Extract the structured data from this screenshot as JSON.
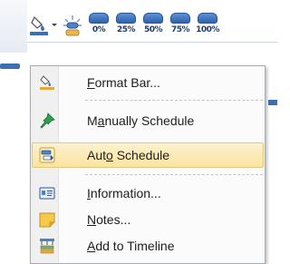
{
  "toolbar": {
    "buttons": [
      {
        "name": "bar-color-icon"
      },
      {
        "name": "dropdown-arrow-icon"
      },
      {
        "name": "milestone-icon"
      }
    ],
    "percent_buttons": [
      {
        "label": "0%",
        "complete": 0
      },
      {
        "label": "25%",
        "complete": 0.25
      },
      {
        "label": "50%",
        "complete": 0.5
      },
      {
        "label": "75%",
        "complete": 0.75
      },
      {
        "label": "100%",
        "complete": 1
      }
    ]
  },
  "menu": {
    "items": [
      {
        "icon": "format-bar-icon",
        "pre": "",
        "key": "F",
        "post": "ormat Bar...",
        "highlighted": false
      },
      {
        "icon": "pin-icon",
        "pre": "M",
        "key": "a",
        "post": "nually Schedule",
        "highlighted": false
      },
      {
        "icon": "auto-schedule-icon",
        "pre": "Aut",
        "key": "o",
        "post": " Schedule",
        "highlighted": true
      },
      {
        "icon": "information-icon",
        "pre": "",
        "key": "I",
        "post": "nformation...",
        "highlighted": false
      },
      {
        "icon": "notes-icon",
        "pre": "",
        "key": "N",
        "post": "otes...",
        "highlighted": false
      },
      {
        "icon": "add-to-timeline-icon",
        "pre": "",
        "key": "A",
        "post": "dd to Timeline",
        "highlighted": false
      }
    ]
  },
  "colors": {
    "accent": "#2e63ad",
    "highlight": "#fbe3a1",
    "menu_bg": "#fbfbfc"
  }
}
